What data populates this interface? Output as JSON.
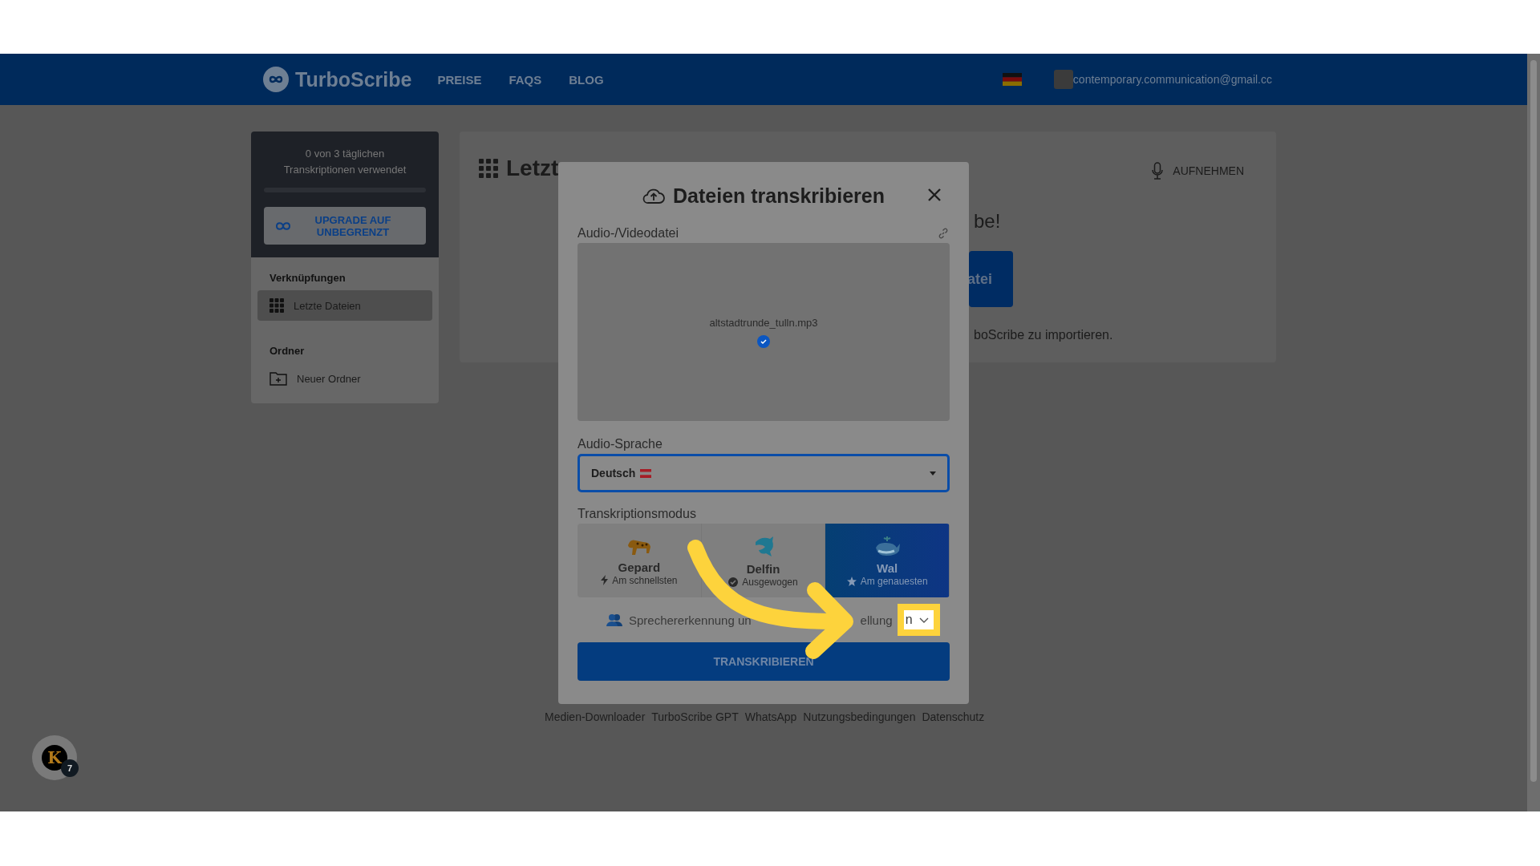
{
  "header": {
    "logo": "TurboScribe",
    "nav": [
      {
        "label": "PREISE"
      },
      {
        "label": "FAQS"
      },
      {
        "label": "BLOG"
      }
    ],
    "account": "contemporary.communication@gmail.cc"
  },
  "sidebar": {
    "usage": "0 von 3 täglichen Transkriptionen verwendet",
    "upgrade": "UPGRADE AUF UNBEGRENZT",
    "sections": [
      {
        "title": "Verknüpfungen",
        "items": [
          {
            "label": "Letzte Dateien",
            "kind": "grid",
            "selected": true
          }
        ]
      },
      {
        "title": "Ordner",
        "items": [
          {
            "label": "Neuer Ordner",
            "kind": "folder",
            "selected": false
          }
        ]
      }
    ]
  },
  "main": {
    "title": "Letzt",
    "record": "AUFNEHMEN",
    "heading_fragment": "be!",
    "button_fragment": "atei",
    "text_fragment": "boScribe zu importieren."
  },
  "dialog": {
    "title": "Dateien transkribieren",
    "file_label": "Audio-/Videodatei",
    "file_name": "altstadtrunde_tulln.mp3",
    "language_label": "Audio-Sprache",
    "language": "Deutsch",
    "mode_label": "Transkriptionsmodus",
    "modes": [
      {
        "name": "Gepard",
        "note": "Am schnellsten",
        "kind": "cheetah",
        "selected": false
      },
      {
        "name": "Delfin",
        "note": "Ausgewogen",
        "kind": "dolphin",
        "selected": false
      },
      {
        "name": "Wal",
        "note": "Am genauesten",
        "kind": "whale",
        "selected": true
      }
    ],
    "speaker_text": "Sprechererkennung un",
    "speaker_text_end": "ellung",
    "speaker_text_tail": "n",
    "submit": "TRANSKRIBIEREN"
  },
  "footer_links": [
    "Medien-Downloader",
    "TurboScribe GPT",
    "WhatsApp",
    "Nutzungsbedingungen",
    "Datenschutz"
  ],
  "chat_widget": {
    "logo_letter": "K",
    "badge": "7"
  }
}
